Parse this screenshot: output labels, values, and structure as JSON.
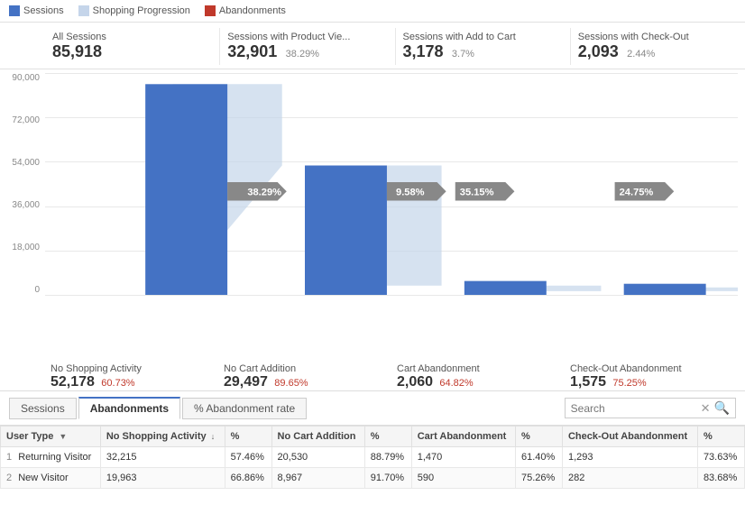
{
  "legend": {
    "items": [
      {
        "label": "Sessions",
        "type": "sessions"
      },
      {
        "label": "Shopping Progression",
        "type": "progression"
      },
      {
        "label": "Abandonments",
        "type": "abandonments"
      }
    ]
  },
  "stats": [
    {
      "label": "All Sessions",
      "value": "85,918",
      "pct": ""
    },
    {
      "label": "Sessions with Product Vie...",
      "value": "32,901",
      "pct": "38.29%"
    },
    {
      "label": "Sessions with Add to Cart",
      "value": "3,178",
      "pct": "3.7%"
    },
    {
      "label": "Sessions with Check-Out",
      "value": "2,093",
      "pct": "2.44%"
    }
  ],
  "yAxis": [
    "90,000",
    "72,000",
    "54,000",
    "36,000",
    "18,000",
    "0"
  ],
  "progressionPcts": [
    "38.29%",
    "9.58%",
    "35.15%",
    "24.75%"
  ],
  "bars": [
    {
      "heightPct": 95,
      "widthPct": 55
    },
    {
      "heightPct": 36,
      "widthPct": 55
    },
    {
      "heightPct": 3.5,
      "widthPct": 55
    },
    {
      "heightPct": 2.5,
      "widthPct": 55
    }
  ],
  "bottomLabels": [
    {
      "label": "No Shopping Activity",
      "value": "52,178",
      "pct": "60.73%"
    },
    {
      "label": "No Cart Addition",
      "value": "29,497",
      "pct": "89.65%"
    },
    {
      "label": "Cart Abandonment",
      "value": "2,060",
      "pct": "64.82%"
    },
    {
      "label": "Check-Out Abandonment",
      "value": "1,575",
      "pct": "75.25%"
    }
  ],
  "tabs": [
    {
      "label": "Sessions",
      "active": false
    },
    {
      "label": "Abandonments",
      "active": true
    },
    {
      "label": "% Abandonment rate",
      "active": false
    }
  ],
  "search": {
    "placeholder": "Search",
    "value": ""
  },
  "tableHeaders": [
    {
      "label": "User Type",
      "sortable": true
    },
    {
      "label": "No Shopping Activity",
      "sortable": true
    },
    {
      "label": "%",
      "sortable": false
    },
    {
      "label": "No Cart Addition",
      "sortable": false
    },
    {
      "label": "%",
      "sortable": false
    },
    {
      "label": "Cart Abandonment",
      "sortable": false
    },
    {
      "label": "%",
      "sortable": false
    },
    {
      "label": "Check-Out Abandonment",
      "sortable": false
    },
    {
      "label": "%",
      "sortable": false
    }
  ],
  "tableRows": [
    {
      "num": "1",
      "userType": "Returning Visitor",
      "noShoppingActivity": "32,215",
      "nsa_pct": "57.46%",
      "noCartAddition": "20,530",
      "nca_pct": "88.79%",
      "cartAbandonment": "1,470",
      "ca_pct": "61.40%",
      "checkoutAbandonment": "1,293",
      "coa_pct": "73.63%"
    },
    {
      "num": "2",
      "userType": "New Visitor",
      "noShoppingActivity": "19,963",
      "nsa_pct": "66.86%",
      "noCartAddition": "8,967",
      "nca_pct": "91.70%",
      "cartAbandonment": "590",
      "ca_pct": "75.26%",
      "checkoutAbandonment": "282",
      "coa_pct": "83.68%"
    }
  ],
  "colors": {
    "blue": "#4472c4",
    "lightBlue": "#c5d5ea",
    "red": "#c0392b",
    "badgeGray": "#888888"
  }
}
